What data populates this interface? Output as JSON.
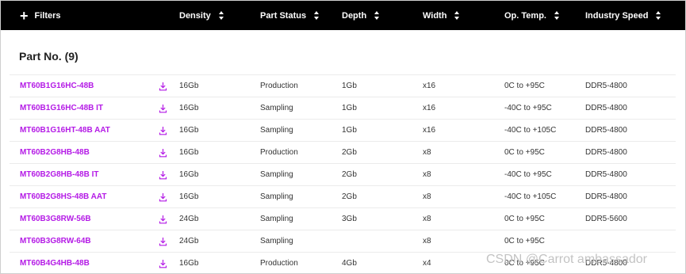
{
  "header": {
    "filters_label": "Filters",
    "columns": [
      "Density",
      "Part Status",
      "Depth",
      "Width",
      "Op. Temp.",
      "Industry Speed"
    ]
  },
  "section": {
    "title": "Part No. (9)"
  },
  "rows": [
    {
      "part": "MT60B1G16HC-48B",
      "density": "16Gb",
      "status": "Production",
      "depth": "1Gb",
      "width": "x16",
      "temp": "0C to +95C",
      "speed": "DDR5-4800"
    },
    {
      "part": "MT60B1G16HC-48B IT",
      "density": "16Gb",
      "status": "Sampling",
      "depth": "1Gb",
      "width": "x16",
      "temp": "-40C to +95C",
      "speed": "DDR5-4800"
    },
    {
      "part": "MT60B1G16HT-48B AAT",
      "density": "16Gb",
      "status": "Sampling",
      "depth": "1Gb",
      "width": "x16",
      "temp": "-40C to +105C",
      "speed": "DDR5-4800"
    },
    {
      "part": "MT60B2G8HB-48B",
      "density": "16Gb",
      "status": "Production",
      "depth": "2Gb",
      "width": "x8",
      "temp": "0C to +95C",
      "speed": "DDR5-4800"
    },
    {
      "part": "MT60B2G8HB-48B IT",
      "density": "16Gb",
      "status": "Sampling",
      "depth": "2Gb",
      "width": "x8",
      "temp": "-40C to +95C",
      "speed": "DDR5-4800"
    },
    {
      "part": "MT60B2G8HS-48B AAT",
      "density": "16Gb",
      "status": "Sampling",
      "depth": "2Gb",
      "width": "x8",
      "temp": "-40C to +105C",
      "speed": "DDR5-4800"
    },
    {
      "part": "MT60B3G8RW-56B",
      "density": "24Gb",
      "status": "Sampling",
      "depth": "3Gb",
      "width": "x8",
      "temp": "0C to +95C",
      "speed": "DDR5-5600"
    },
    {
      "part": "MT60B3G8RW-64B",
      "density": "24Gb",
      "status": "Sampling",
      "depth": "",
      "width": "x8",
      "temp": "0C to +95C",
      "speed": ""
    },
    {
      "part": "MT60B4G4HB-48B",
      "density": "16Gb",
      "status": "Production",
      "depth": "4Gb",
      "width": "x4",
      "temp": "0C to +95C",
      "speed": "DDR5-4800"
    }
  ],
  "watermark": "CSDN @Carrot ambassador",
  "colors": {
    "accent": "#b41ae6",
    "header_bg": "#000000"
  }
}
